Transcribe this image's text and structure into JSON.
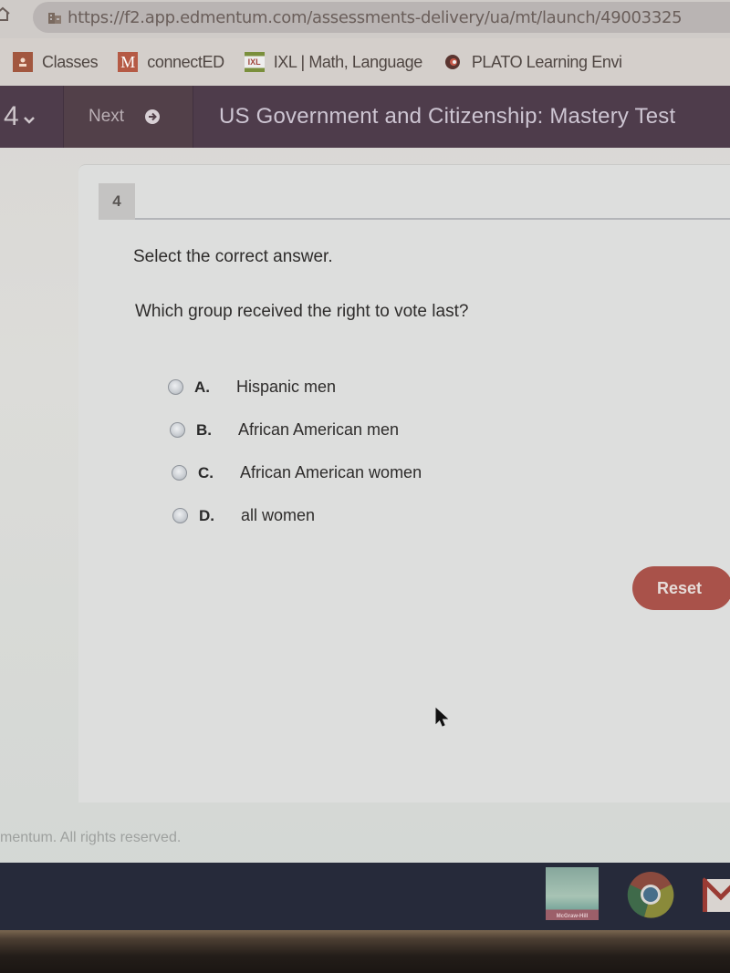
{
  "browser": {
    "url": "https://f2.app.edmentum.com/assessments-delivery/ua/mt/launch/49003325",
    "bookmarks": [
      {
        "label": "Classes",
        "icon": "google-classroom-icon",
        "color": "#a2573f"
      },
      {
        "label": "connectED",
        "icon": "mcgraw-hill-m-icon",
        "color": "#b55a45"
      },
      {
        "label": "IXL | Math, Language",
        "icon": "ixl-icon",
        "color": "#7a8f3c"
      },
      {
        "label": "PLATO Learning Envi",
        "icon": "plato-icon",
        "color": "#6a3a35"
      }
    ]
  },
  "header": {
    "question_number": "4",
    "next_label": "Next",
    "title": "US Government and Citizenship: Mastery Test",
    "bg_color": "#4e3c4b"
  },
  "question": {
    "number": "4",
    "instruction": "Select the correct answer.",
    "prompt": "Which group received the right to vote last?",
    "options": [
      {
        "letter": "A.",
        "text": "Hispanic men",
        "selected": false
      },
      {
        "letter": "B.",
        "text": "African American men",
        "selected": false
      },
      {
        "letter": "C.",
        "text": "African American women",
        "selected": false
      },
      {
        "letter": "D.",
        "text": "all women",
        "selected": false
      }
    ],
    "reset_label": "Reset",
    "reset_color": "#a9524a"
  },
  "footer": {
    "copyright": "mentum. All rights reserved."
  },
  "shelf": {
    "apps": [
      {
        "name": "McGraw-Hill",
        "label": "McGraw-Hill"
      },
      {
        "name": "Chrome",
        "label": ""
      },
      {
        "name": "Gmail",
        "label": ""
      }
    ]
  }
}
